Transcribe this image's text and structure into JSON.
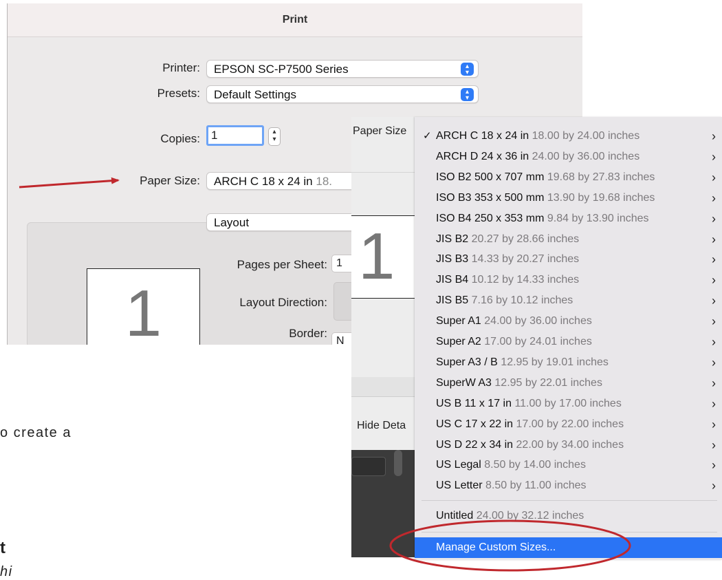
{
  "dialog": {
    "title": "Print",
    "printer_label": "Printer:",
    "printer_value": "EPSON SC-P7500 Series",
    "presets_label": "Presets:",
    "presets_value": "Default Settings",
    "copies_label": "Copies:",
    "copies_value": "1",
    "paper_size_label": "Paper Size:",
    "paper_size_value_name": "ARCH C 18 x 24 in",
    "paper_size_value_dim": "18.",
    "section_value": "Layout",
    "preview_page_number": "1",
    "pages_per_sheet_label": "Pages per Sheet:",
    "pages_per_sheet_value": "1",
    "layout_direction_label": "Layout Direction:",
    "border_label": "Border:",
    "border_value": "N"
  },
  "overlay": {
    "paper_size_label": "Paper Size",
    "preview_page_number": "1",
    "hide_details_label": "Hide Deta"
  },
  "menu": {
    "items": [
      {
        "checked": true,
        "name": "ARCH C 18 x 24 in",
        "dims": "18.00 by 24.00 inches",
        "submenu": true
      },
      {
        "checked": false,
        "name": "ARCH D 24 x 36 in",
        "dims": "24.00 by 36.00 inches",
        "submenu": true
      },
      {
        "checked": false,
        "name": "ISO B2 500 x 707 mm",
        "dims": "19.68 by 27.83 inches",
        "submenu": true
      },
      {
        "checked": false,
        "name": "ISO B3 353 x 500 mm",
        "dims": "13.90 by 19.68 inches",
        "submenu": true
      },
      {
        "checked": false,
        "name": "ISO B4 250 x 353 mm",
        "dims": "9.84 by 13.90 inches",
        "submenu": true
      },
      {
        "checked": false,
        "name": "JIS B2",
        "dims": "20.27 by 28.66 inches",
        "submenu": true
      },
      {
        "checked": false,
        "name": "JIS B3",
        "dims": "14.33 by 20.27 inches",
        "submenu": true
      },
      {
        "checked": false,
        "name": "JIS B4",
        "dims": "10.12 by 14.33 inches",
        "submenu": true
      },
      {
        "checked": false,
        "name": "JIS B5",
        "dims": "7.16 by 10.12 inches",
        "submenu": true
      },
      {
        "checked": false,
        "name": "Super A1",
        "dims": "24.00 by 36.00 inches",
        "submenu": true
      },
      {
        "checked": false,
        "name": "Super A2",
        "dims": "17.00 by 24.01 inches",
        "submenu": true
      },
      {
        "checked": false,
        "name": "Super A3 / B",
        "dims": "12.95 by 19.01 inches",
        "submenu": true
      },
      {
        "checked": false,
        "name": "SuperW A3",
        "dims": "12.95 by 22.01 inches",
        "submenu": true
      },
      {
        "checked": false,
        "name": "US B 11 x 17 in",
        "dims": "11.00 by 17.00 inches",
        "submenu": true
      },
      {
        "checked": false,
        "name": "US C 17 x 22 in",
        "dims": "17.00 by 22.00 inches",
        "submenu": true
      },
      {
        "checked": false,
        "name": "US D 22 x 34 in",
        "dims": "22.00 by 34.00 inches",
        "submenu": true
      },
      {
        "checked": false,
        "name": "US Legal",
        "dims": "8.50 by 14.00 inches",
        "submenu": true
      },
      {
        "checked": false,
        "name": "US Letter",
        "dims": "8.50 by 11.00 inches",
        "submenu": true
      }
    ],
    "untitled": {
      "name": "Untitled",
      "dims": "24.00 by 32.12 inches"
    },
    "manage_label": "Manage Custom Sizes...",
    "check_glyph": "✓",
    "chevron_glyph": "›"
  },
  "page_text": {
    "fragment_1": "o create a",
    "fragment_2": "t",
    "fragment_3": "hi"
  },
  "colors": {
    "accent": "#2a74f5",
    "annotation_red": "#c0282d"
  },
  "icons": {
    "popup_arrows": "up-down-chevron-icon",
    "stepper": "stepper-icon",
    "arrow": "red-arrow-annotation",
    "circle": "red-ellipse-annotation"
  }
}
